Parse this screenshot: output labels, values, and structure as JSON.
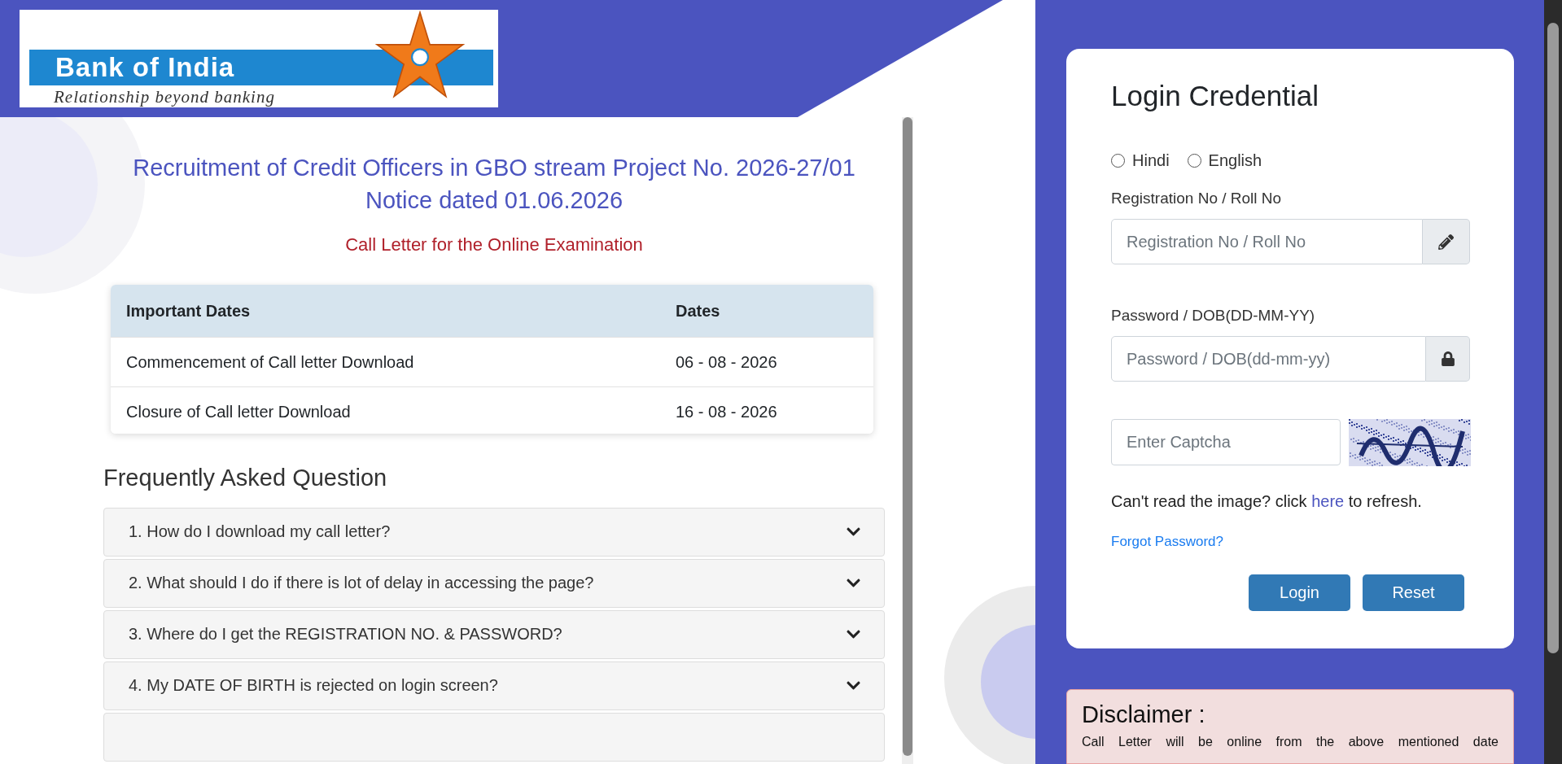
{
  "logo": {
    "name": "Bank of India",
    "tagline": "Relationship beyond banking"
  },
  "notice": {
    "title": "Recruitment of Credit Officers in GBO stream Project No. 2026-27/01 Notice dated 01.06.2026",
    "subtitle": "Call Letter for the Online Examination"
  },
  "dates_table": {
    "columns": [
      "Important Dates",
      "Dates"
    ],
    "rows": [
      [
        "Commencement of Call letter Download",
        "06 - 08 - 2026"
      ],
      [
        "Closure of Call letter Download",
        "16 - 08 - 2026"
      ]
    ]
  },
  "faq": {
    "heading": "Frequently Asked Question",
    "items": [
      {
        "question": "1. How do I download my call letter?",
        "expanded": false
      },
      {
        "question": "2. What should I do if there is lot of delay in accessing the page?",
        "expanded": false
      },
      {
        "question": "3. Where do I get the REGISTRATION NO. & PASSWORD?",
        "expanded": false
      },
      {
        "question": "4. My DATE OF BIRTH is rejected on login screen?",
        "expanded": false
      }
    ]
  },
  "login": {
    "title": "Login Credential",
    "languages": [
      {
        "label": "Hindi",
        "selected": false
      },
      {
        "label": "English",
        "selected": false
      }
    ],
    "fields": [
      {
        "label": "Registration No / Roll No",
        "placeholder": "Registration No / Roll No",
        "kind": "text"
      },
      {
        "label": "Password / DOB(DD-MM-YY)",
        "placeholder": "Password / DOB(dd-mm-yy)",
        "kind": "password"
      }
    ],
    "captcha": {
      "placeholder": "Enter Captcha"
    },
    "help": {
      "before": "Can't read the image? click",
      "link": "here",
      "after": "to refresh."
    },
    "forgot": "Forgot Password?",
    "buttons": [
      "Login",
      "Reset"
    ]
  },
  "disclaimer": {
    "title": "Disclaimer :",
    "text": "Call Letter will be online from the above mentioned date"
  }
}
